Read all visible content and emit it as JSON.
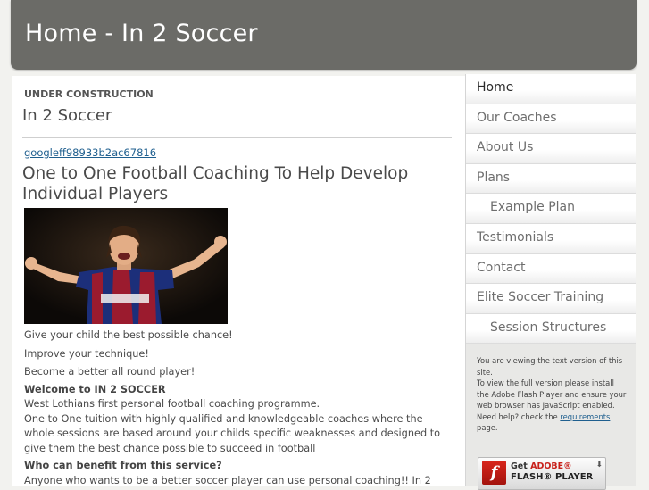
{
  "site": {
    "title": "Home - In 2 Soccer"
  },
  "main": {
    "breadcrumb": "UNDER CONSTRUCTION",
    "subtitle": "In 2 Soccer",
    "google_link": "googleff98933b2ac67816",
    "headline": "One to One Football Coaching To Help Develop Individual Players",
    "photo_desc": "soccer-player-celebrating",
    "lines": [
      "Give your child the best possible chance!",
      "Improve your technique!",
      "Become a better all round player!"
    ],
    "welcome_heading": "Welcome to IN 2 SOCCER",
    "welcome_text_1": "West Lothians first personal football coaching programme.",
    "welcome_text_2": "One to One tuition with highly qualified and knowledgeable coaches where the whole sessions are based around your childs specific weaknesses and designed to give them the best chance possible to succeed in football",
    "benefit_heading": "Who can benefit from this service?",
    "benefit_text": "Anyone who wants to be a better soccer player can use personal coaching!! In 2"
  },
  "nav": {
    "items": [
      {
        "label": "Home",
        "active": true,
        "sub": false
      },
      {
        "label": "Our Coaches",
        "active": false,
        "sub": false
      },
      {
        "label": "About Us",
        "active": false,
        "sub": false
      },
      {
        "label": "Plans",
        "active": false,
        "sub": false
      },
      {
        "label": "Example Plan",
        "active": false,
        "sub": true
      },
      {
        "label": "Testimonials",
        "active": false,
        "sub": false
      },
      {
        "label": "Contact",
        "active": false,
        "sub": false
      },
      {
        "label": "Elite Soccer Training",
        "active": false,
        "sub": false
      },
      {
        "label": "Session Structures",
        "active": false,
        "sub": true
      }
    ]
  },
  "info": {
    "line1": "You are viewing the text version of this site.",
    "line2": "To view the full version please install the Adobe Flash Player and ensure your web browser has JavaScript enabled.",
    "line3_prefix": "Need help? check the ",
    "line3_link": "requirements",
    "line3_suffix": " page.",
    "badge_get": "Get ",
    "badge_adobe": "ADOBE®",
    "badge_player": "FLASH® PLAYER",
    "badge_icon": "flash-logo-icon"
  }
}
